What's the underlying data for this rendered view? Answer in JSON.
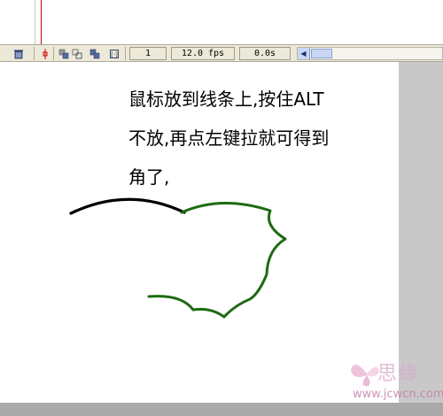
{
  "timeline": {
    "frame_number": "1",
    "frame_rate": "12.0 fps",
    "elapsed_time": "0.0s"
  },
  "icons": {
    "delete_layer": "trash-icon",
    "center_frame": "center-frame-icon",
    "onion_skin": "onion-skin-icon",
    "onion_skin_outlines": "onion-skin-outlines-icon",
    "edit_multiple_frames": "edit-multiple-frames-icon",
    "modify_onion_markers": "modify-onion-markers-icon",
    "scroll_left": "arrow-left-icon"
  },
  "stage": {
    "instruction_lines": [
      "鼠标放到线条上,按住ALT",
      "不放,再点左键拉就可得到",
      "角了,"
    ],
    "colors": {
      "black_stroke": "#000000",
      "green_stroke": "#1e6b12"
    }
  },
  "watermark": {
    "chars": "思缘",
    "url": "www.jcwcn.com"
  }
}
